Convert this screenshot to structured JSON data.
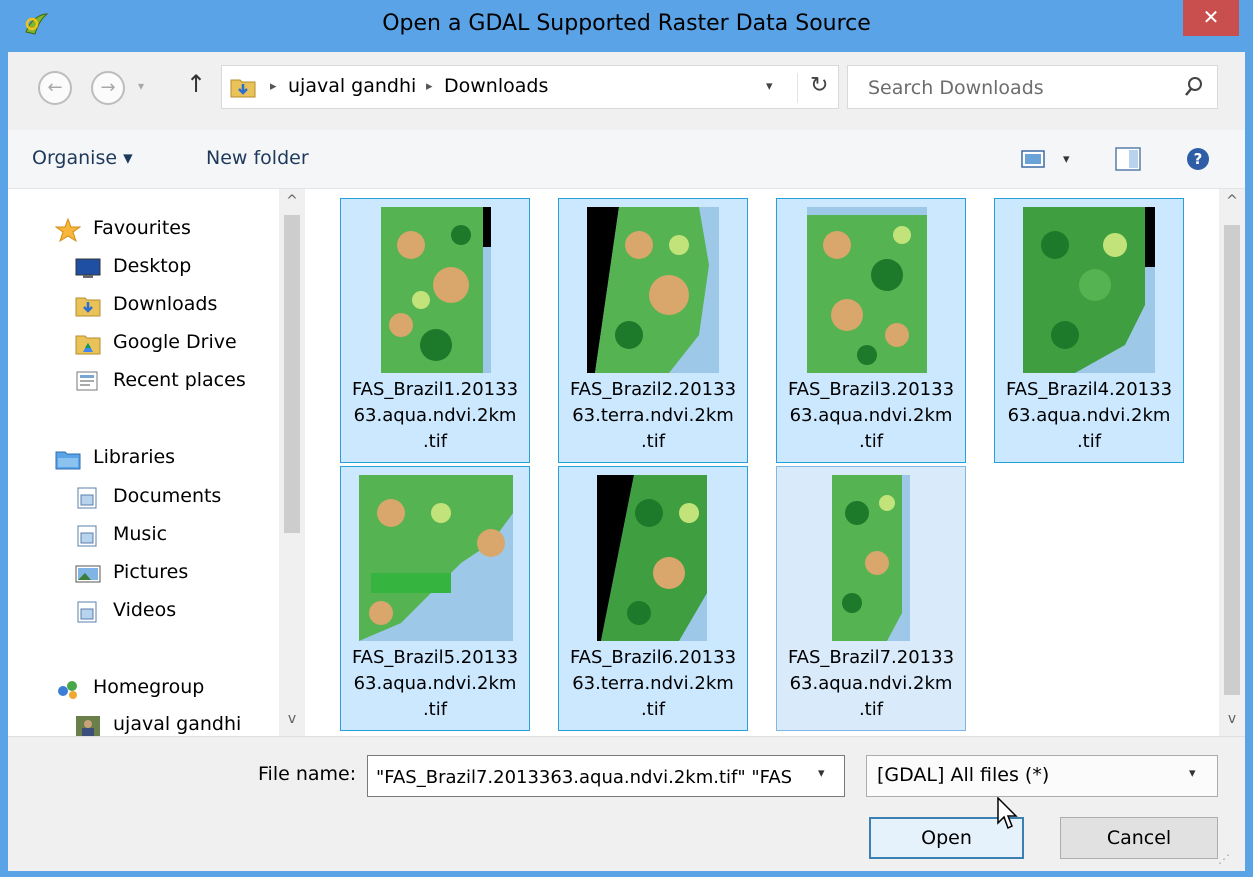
{
  "window": {
    "title": "Open a GDAL Supported Raster Data Source",
    "close_glyph": "✕"
  },
  "address": {
    "crumbs": [
      "ujaval gandhi",
      "Downloads"
    ],
    "back_glyph": "←",
    "forward_glyph": "→",
    "up_glyph": "↑",
    "dropdown_glyph": "▾",
    "refresh_glyph": "↻"
  },
  "search": {
    "placeholder": "Search Downloads"
  },
  "toolbar": {
    "organise_label": "Organise ▾",
    "new_folder_label": "New folder"
  },
  "navigation": {
    "favourites": {
      "label": "Favourites",
      "items": [
        {
          "label": "Desktop",
          "icon": "desktop-icon"
        },
        {
          "label": "Downloads",
          "icon": "downloads-folder-icon"
        },
        {
          "label": "Google Drive",
          "icon": "google-drive-icon"
        },
        {
          "label": "Recent places",
          "icon": "recent-places-icon"
        }
      ]
    },
    "libraries": {
      "label": "Libraries",
      "items": [
        {
          "label": "Documents",
          "icon": "documents-library-icon"
        },
        {
          "label": "Music",
          "icon": "music-library-icon"
        },
        {
          "label": "Pictures",
          "icon": "pictures-library-icon"
        },
        {
          "label": "Videos",
          "icon": "videos-library-icon"
        }
      ]
    },
    "homegroup": {
      "label": "Homegroup",
      "items": [
        {
          "label": "ujaval gandhi",
          "icon": "user-avatar-icon"
        }
      ]
    }
  },
  "files": [
    {
      "name": "FAS_Brazil1.2013363.aqua.ndvi.2km.tif",
      "line1": "FAS_Brazil1.20133",
      "line2": "63.aqua.ndvi.2km",
      "line3": ".tif",
      "selected": true
    },
    {
      "name": "FAS_Brazil2.2013363.terra.ndvi.2km.tif",
      "line1": "FAS_Brazil2.20133",
      "line2": "63.terra.ndvi.2km",
      "line3": ".tif",
      "selected": true
    },
    {
      "name": "FAS_Brazil3.2013363.aqua.ndvi.2km.tif",
      "line1": "FAS_Brazil3.20133",
      "line2": "63.aqua.ndvi.2km",
      "line3": ".tif",
      "selected": true
    },
    {
      "name": "FAS_Brazil4.2013363.aqua.ndvi.2km.tif",
      "line1": "FAS_Brazil4.20133",
      "line2": "63.aqua.ndvi.2km",
      "line3": ".tif",
      "selected": true
    },
    {
      "name": "FAS_Brazil5.2013363.aqua.ndvi.2km.tif",
      "line1": "FAS_Brazil5.20133",
      "line2": "63.aqua.ndvi.2km",
      "line3": ".tif",
      "selected": true
    },
    {
      "name": "FAS_Brazil6.2013363.terra.ndvi.2km.tif",
      "line1": "FAS_Brazil6.20133",
      "line2": "63.terra.ndvi.2km",
      "line3": ".tif",
      "selected": true
    },
    {
      "name": "FAS_Brazil7.2013363.aqua.ndvi.2km.tif",
      "line1": "FAS_Brazil7.20133",
      "line2": "63.aqua.ndvi.2km",
      "line3": ".tif",
      "selected": true
    }
  ],
  "bottom": {
    "file_name_label": "File name:",
    "file_name_value": "\"FAS_Brazil7.2013363.aqua.ndvi.2km.tif\" \"FAS",
    "file_type_value": "[GDAL] All files (*)",
    "open_label": "Open",
    "cancel_label": "Cancel"
  },
  "colors": {
    "titlebar": "#5ba3e7",
    "close": "#c94f4f",
    "selection_fill": "#cce8ff",
    "selection_border": "#26a0da"
  }
}
